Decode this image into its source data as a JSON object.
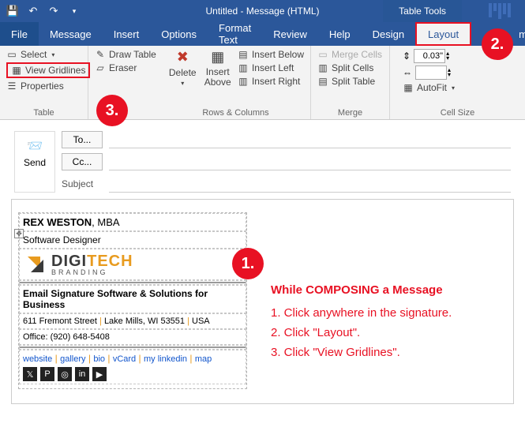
{
  "titlebar": {
    "title": "Untitled  -  Message (HTML)",
    "context_tab": "Table Tools"
  },
  "menubar": {
    "file": "File",
    "message": "Message",
    "insert": "Insert",
    "options": "Options",
    "format_text": "Format Text",
    "review": "Review",
    "help": "Help",
    "design": "Design",
    "layout": "Layout",
    "cut_tab": "me"
  },
  "ribbon": {
    "table": {
      "select": "Select",
      "view_gridlines": "View Gridlines",
      "properties": "Properties",
      "group": "Table"
    },
    "draw": {
      "draw_table": "Draw Table",
      "eraser": "Eraser"
    },
    "rows_cols": {
      "delete": "Delete",
      "insert_above": "Insert Above",
      "insert_below": "Insert Below",
      "insert_left": "Insert Left",
      "insert_right": "Insert Right",
      "group": "Rows & Columns"
    },
    "merge": {
      "merge_cells": "Merge Cells",
      "split_cells": "Split Cells",
      "split_table": "Split Table",
      "group": "Merge"
    },
    "cell_size": {
      "autofit": "AutoFit",
      "height": "0.03\"",
      "group": "Cell Size"
    }
  },
  "compose": {
    "send": "Send",
    "to": "To...",
    "cc": "Cc...",
    "subject": "Subject"
  },
  "signature": {
    "name_bold": "REX WESTON",
    "name_suffix": ", MBA",
    "title": "Software Designer",
    "logo_word1_a": "DIGI",
    "logo_word1_b": "TECH",
    "logo_word2": "BRANDING",
    "tagline": "Email Signature Software & Solutions for Business",
    "addr1": "611 Fremont Street",
    "addr2": "Lake Mills, WI 53551",
    "addr3": "USA",
    "office_label": "Office:",
    "office_phone": "(920) 648-5408",
    "links": [
      "website",
      "gallery",
      "bio",
      "vCard",
      "my linkedin",
      "map"
    ],
    "social_icons": [
      "twitter",
      "pinterest",
      "instagram",
      "linkedin",
      "youtube"
    ]
  },
  "callouts": {
    "heading": "While COMPOSING a Message",
    "l1": "1. Click anywhere in the signature.",
    "l2": "2. Click \"Layout\".",
    "l3": "3. Click \"View Gridlines\".",
    "n1": "1.",
    "n2": "2.",
    "n3": "3."
  },
  "colors": {
    "accent": "#e81123",
    "outlook_blue": "#2b579a",
    "logo_orange": "#e89b1f",
    "logo_dark": "#3a3a3a"
  }
}
